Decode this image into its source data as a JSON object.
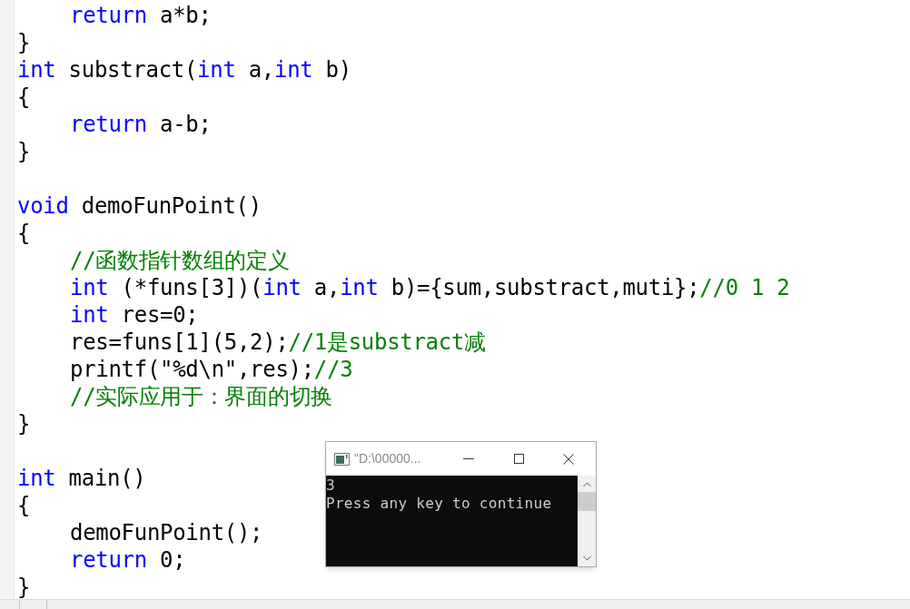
{
  "editor": {
    "lines": [
      {
        "kind": "code",
        "indented": true,
        "tokens": [
          {
            "kind": "keyword",
            "text": "return"
          },
          {
            "kind": "plain",
            "text": " a*b;"
          }
        ]
      },
      {
        "kind": "code",
        "indented": false,
        "tokens": [
          {
            "kind": "plain",
            "text": "}"
          }
        ]
      },
      {
        "kind": "code",
        "indented": false,
        "tokens": [
          {
            "kind": "keyword",
            "text": "int"
          },
          {
            "kind": "plain",
            "text": " substract("
          },
          {
            "kind": "keyword",
            "text": "int"
          },
          {
            "kind": "plain",
            "text": " a,"
          },
          {
            "kind": "keyword",
            "text": "int"
          },
          {
            "kind": "plain",
            "text": " b)"
          }
        ]
      },
      {
        "kind": "code",
        "indented": false,
        "tokens": [
          {
            "kind": "plain",
            "text": "{"
          }
        ]
      },
      {
        "kind": "code",
        "indented": true,
        "tokens": [
          {
            "kind": "keyword",
            "text": "return"
          },
          {
            "kind": "plain",
            "text": " a-b;"
          }
        ]
      },
      {
        "kind": "code",
        "indented": false,
        "tokens": [
          {
            "kind": "plain",
            "text": "}"
          }
        ]
      },
      {
        "kind": "blank"
      },
      {
        "kind": "code",
        "indented": false,
        "tokens": [
          {
            "kind": "keyword",
            "text": "void"
          },
          {
            "kind": "plain",
            "text": " demoFunPoint()"
          }
        ]
      },
      {
        "kind": "code",
        "indented": false,
        "tokens": [
          {
            "kind": "plain",
            "text": "{"
          }
        ]
      },
      {
        "kind": "code",
        "indented": true,
        "tokens": [
          {
            "kind": "comment",
            "text": "//函数指针数组的定义"
          }
        ]
      },
      {
        "kind": "code",
        "indented": true,
        "tokens": [
          {
            "kind": "keyword",
            "text": "int"
          },
          {
            "kind": "plain",
            "text": " (*funs[3])("
          },
          {
            "kind": "keyword",
            "text": "int"
          },
          {
            "kind": "plain",
            "text": " a,"
          },
          {
            "kind": "keyword",
            "text": "int"
          },
          {
            "kind": "plain",
            "text": " b)={sum,substract,muti};"
          },
          {
            "kind": "comment",
            "text": "//0 1 2"
          }
        ]
      },
      {
        "kind": "code",
        "indented": true,
        "tokens": [
          {
            "kind": "keyword",
            "text": "int"
          },
          {
            "kind": "plain",
            "text": " res=0;"
          }
        ]
      },
      {
        "kind": "code",
        "indented": true,
        "tokens": [
          {
            "kind": "plain",
            "text": "res=funs[1](5,2);"
          },
          {
            "kind": "comment",
            "text": "//1是substract减"
          }
        ]
      },
      {
        "kind": "code",
        "indented": true,
        "tokens": [
          {
            "kind": "plain",
            "text": "printf(\"%d\\n\",res);"
          },
          {
            "kind": "comment",
            "text": "//3"
          }
        ]
      },
      {
        "kind": "code",
        "indented": true,
        "tokens": [
          {
            "kind": "comment",
            "text": "//实际应用于：界面的切换"
          }
        ]
      },
      {
        "kind": "code",
        "indented": false,
        "tokens": [
          {
            "kind": "plain",
            "text": "}"
          }
        ]
      },
      {
        "kind": "blank"
      },
      {
        "kind": "code",
        "indented": false,
        "tokens": [
          {
            "kind": "keyword",
            "text": "int"
          },
          {
            "kind": "plain",
            "text": " main()"
          }
        ]
      },
      {
        "kind": "code",
        "indented": false,
        "tokens": [
          {
            "kind": "plain",
            "text": "{"
          }
        ]
      },
      {
        "kind": "code",
        "indented": true,
        "tokens": [
          {
            "kind": "plain",
            "text": "demoFunPoint();"
          }
        ]
      },
      {
        "kind": "code",
        "indented": true,
        "tokens": [
          {
            "kind": "keyword",
            "text": "return"
          },
          {
            "kind": "plain",
            "text": " 0;"
          }
        ]
      },
      {
        "kind": "code",
        "indented": false,
        "tokens": [
          {
            "kind": "plain",
            "text": "}"
          }
        ]
      }
    ]
  },
  "console": {
    "title": "\"D:\\00000...",
    "output": [
      "3",
      "Press any key to continue"
    ]
  }
}
